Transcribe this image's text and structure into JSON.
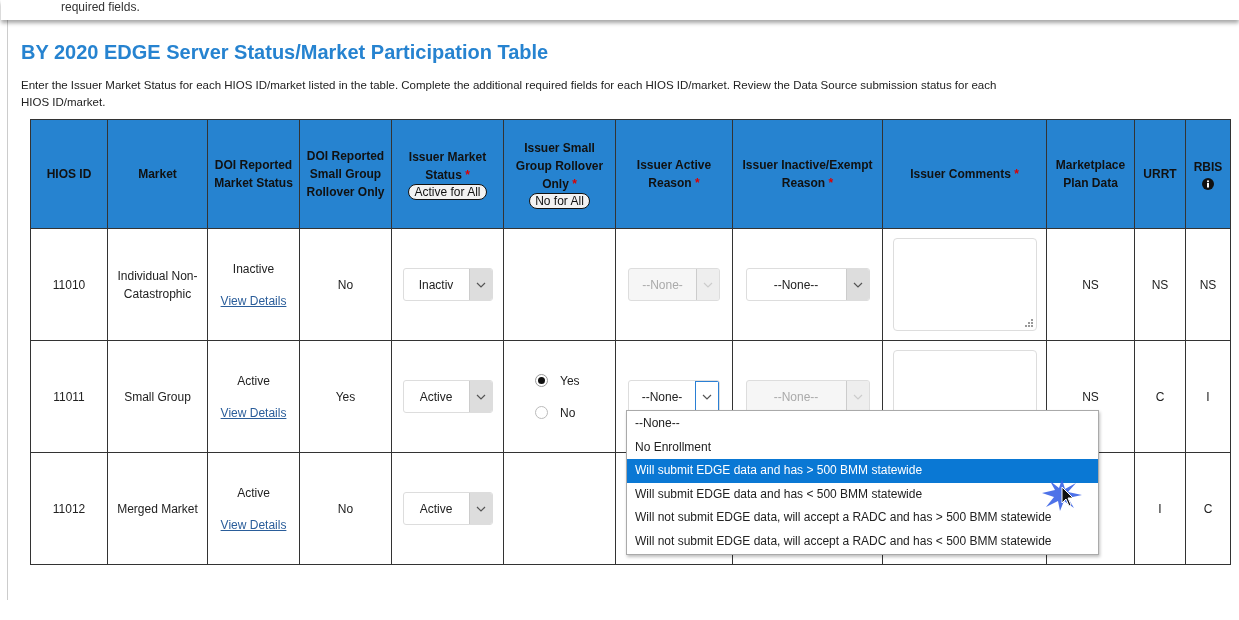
{
  "top_fragment": "required fields.",
  "title": "BY 2020 EDGE Server Status/Market Participation Table",
  "instructions": "Enter the Issuer Market Status for each HIOS ID/market listed in the table. Complete the additional required fields for each HIOS ID/market. Review the Data Source submission status for each HIOS ID/market.",
  "table": {
    "columns": [
      {
        "label": "HIOS ID"
      },
      {
        "label": "Market"
      },
      {
        "label": "DOI Reported Market Status"
      },
      {
        "label": "DOI Reported Small Group Rollover Only"
      },
      {
        "label": "Issuer Market Status",
        "required_mark": "*",
        "button": "Active for All"
      },
      {
        "label": "Issuer Small Group Rollover Only",
        "required_mark": "*",
        "button": "No for All"
      },
      {
        "label": "Issuer Active Reason",
        "required_mark": "*"
      },
      {
        "label": "Issuer Inactive/Exempt Reason",
        "required_mark": "*"
      },
      {
        "label": "Issuer Comments",
        "required_mark": "*"
      },
      {
        "label": "Marketplace Plan Data"
      },
      {
        "label": "URRT"
      },
      {
        "label": "RBIS",
        "info_icon": true
      }
    ],
    "rows": [
      {
        "hios_id": "11010",
        "market": "Individual Non-Catastrophic",
        "doi_status": "Inactive",
        "link": "View Details",
        "doi_rollover": "No",
        "issuer_status": {
          "value": "Inactiv",
          "disabled": false
        },
        "active_reason": {
          "value": "--None-",
          "disabled": true,
          "focused": false
        },
        "inactive_reason": {
          "value": "--None--",
          "disabled": false
        },
        "comments_field": true,
        "comments_grip": true,
        "marketplace": "NS",
        "urrt": "NS",
        "rbis": "NS"
      },
      {
        "hios_id": "11011",
        "market": "Small Group",
        "doi_status": "Active",
        "link": "View Details",
        "doi_rollover": "Yes",
        "issuer_status": {
          "value": "Active",
          "disabled": false
        },
        "rollover_options": [
          {
            "label": "Yes",
            "selected": true
          },
          {
            "label": "No",
            "selected": false
          }
        ],
        "active_reason": {
          "value": "--None-",
          "disabled": false,
          "focused": true,
          "open_options": [
            {
              "label": "--None--",
              "selected": false
            },
            {
              "label": "No Enrollment",
              "selected": false
            },
            {
              "label": "Will submit EDGE data and has > 500 BMM statewide",
              "selected": true
            },
            {
              "label": "Will submit EDGE data and has < 500 BMM statewide",
              "selected": false
            },
            {
              "label": "Will not submit EDGE data, will accept a RADC and has > 500 BMM statewide",
              "selected": false
            },
            {
              "label": "Will not submit EDGE data, will accept a RADC and has < 500 BMM statewide",
              "selected": false
            }
          ]
        },
        "inactive_reason": {
          "value": "--None--",
          "disabled": true
        },
        "comments_field": true,
        "marketplace": "NS",
        "urrt": "C",
        "rbis": "I"
      },
      {
        "hios_id": "11012",
        "market": "Merged Market",
        "doi_status": "Active",
        "link": "View Details",
        "doi_rollover": "No",
        "issuer_status": {
          "value": "Active",
          "disabled": false
        },
        "urrt": "I",
        "rbis": "C"
      }
    ]
  }
}
